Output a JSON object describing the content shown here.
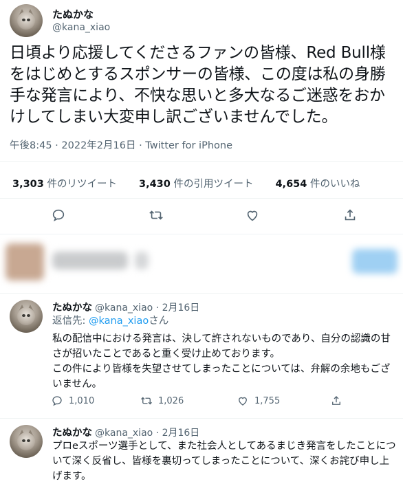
{
  "main": {
    "name": "たぬかな",
    "handle": "@kana_xiao",
    "text": "日頃より応援してくださるファンの皆様、Red Bull様をはじめとするスポンサーの皆様、この度は私の身勝手な発言により、不快な思いと多大なるご迷惑をおかけしてしまい大変申し訳ございませんでした。",
    "timestamp": "午後8:45 · 2022年2月16日 · Twitter for iPhone",
    "stats": [
      {
        "num": "3,303",
        "label": "件のリツイート"
      },
      {
        "num": "3,430",
        "label": "件の引用ツイート"
      },
      {
        "num": "4,654",
        "label": "件のいいね"
      }
    ],
    "actions": [
      "reply-icon",
      "retweet-icon",
      "like-icon",
      "share-icon"
    ]
  },
  "reply1": {
    "name": "たぬかな",
    "handle_date": "@kana_xiao · 2月16日",
    "reply_to_prefix": "返信先: ",
    "reply_to_handle": "@kana_xiao",
    "reply_to_suffix": "さん",
    "text_p1": "私の配信中における発言は、決して許されないものであり、自分の認識の甘さが招いたことであると重く受け止めております。",
    "text_p2": "この件により皆様を失望させてしまったことについては、弁解の余地もございません。",
    "reply_count": "1,010",
    "retweet_count": "1,026",
    "like_count": "1,755"
  },
  "reply2": {
    "name": "たぬかな",
    "handle_date": "@kana_xiao · 2月16日",
    "text": "プロeスポーツ選手として、また社会人としてあるまじき発言をしたことについて深く反省し、皆様を裏切ってしまったことについて、深くお詫び申し上げます。"
  }
}
